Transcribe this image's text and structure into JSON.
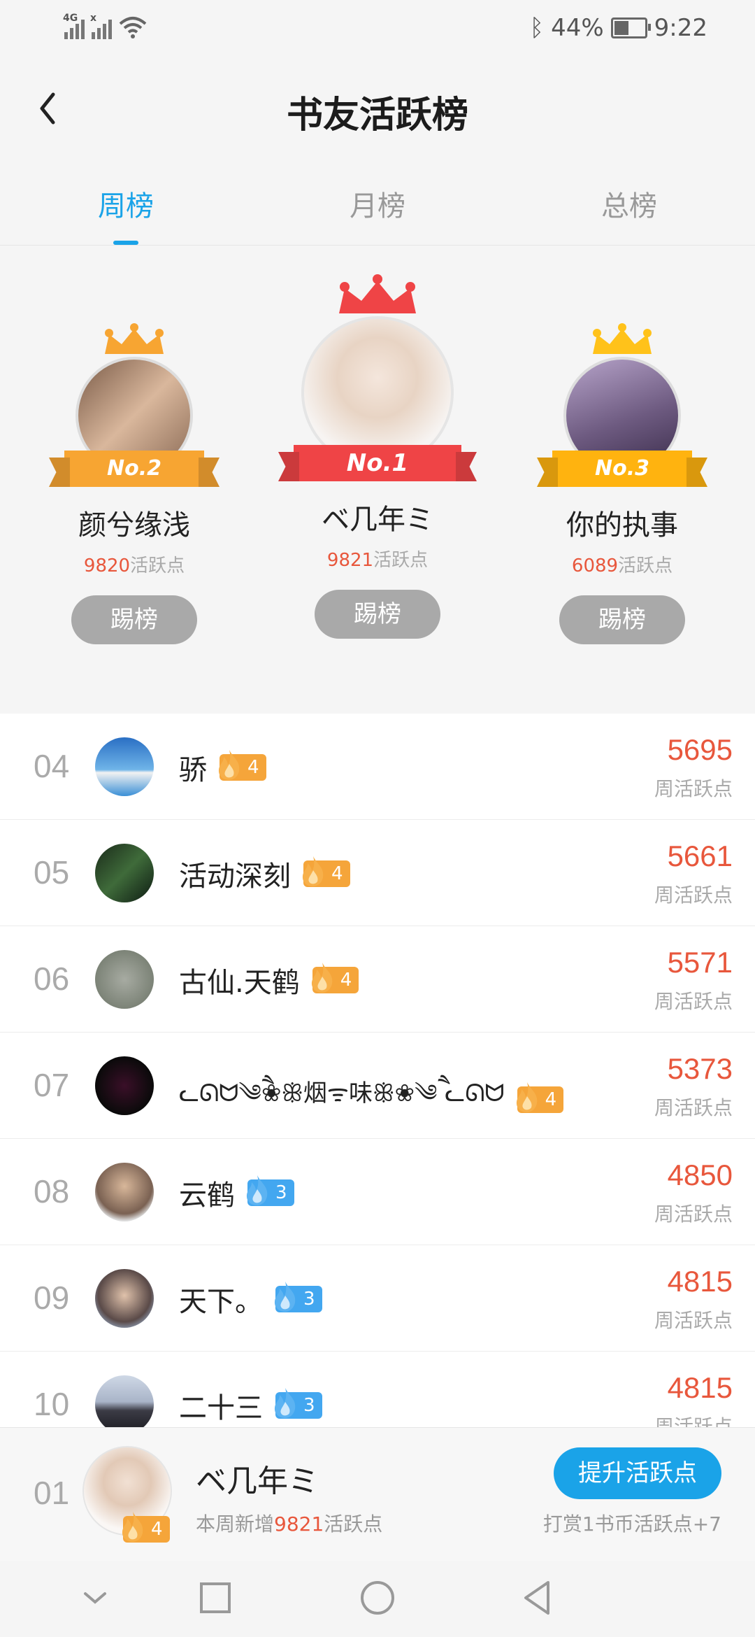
{
  "status_bar": {
    "net1": "4G",
    "net2": "x",
    "battery_text": "44%",
    "battery_level": 0.44,
    "time": "9:22"
  },
  "header": {
    "title": "书友活跃榜"
  },
  "tabs": [
    {
      "label": "周榜",
      "active": true
    },
    {
      "label": "月榜",
      "active": false
    },
    {
      "label": "总榜",
      "active": false
    }
  ],
  "podium": {
    "first": {
      "rank_label": "No.1",
      "name": "ベ几年ミ",
      "score": "9821",
      "unit": "活跃点",
      "button": "踢榜",
      "color": "#ef4446"
    },
    "second": {
      "rank_label": "No.2",
      "name": "颜兮缘浅",
      "score": "9820",
      "unit": "活跃点",
      "button": "踢榜",
      "color": "#f7a532"
    },
    "third": {
      "rank_label": "No.3",
      "name": "你的执事",
      "score": "6089",
      "unit": "活跃点",
      "button": "踢榜",
      "color": "#ffb30f"
    }
  },
  "list": [
    {
      "rank": "04",
      "name": "骄",
      "level": "4",
      "badge": "orange",
      "score": "5695",
      "label": "周活跃点"
    },
    {
      "rank": "05",
      "name": "活动深刻",
      "level": "4",
      "badge": "orange",
      "score": "5661",
      "label": "周活跃点"
    },
    {
      "rank": "06",
      "name": "古仙.天鹤",
      "level": "4",
      "badge": "orange",
      "score": "5571",
      "label": "周活跃点"
    },
    {
      "rank": "07",
      "name": "ᓚᘏᗢ༄ཻ❀ꕥ烟ᯤ味ꕥ❀༄ཻ ᓚᘏᗢ",
      "level": "4",
      "badge": "orange",
      "score": "5373",
      "label": "周活跃点"
    },
    {
      "rank": "08",
      "name": "云鹤",
      "level": "3",
      "badge": "blue",
      "score": "4850",
      "label": "周活跃点"
    },
    {
      "rank": "09",
      "name": "天下。",
      "level": "3",
      "badge": "blue",
      "score": "4815",
      "label": "周活跃点"
    },
    {
      "rank": "10",
      "name": "二十三",
      "level": "3",
      "badge": "blue",
      "score": "4815",
      "label": "周活跃点"
    }
  ],
  "my_rank": {
    "rank": "01",
    "name": "ベ几年ミ",
    "level": "4",
    "sub_prefix": "本周新增",
    "sub_value": "9821",
    "sub_suffix": "活跃点",
    "boost_button": "提升活跃点",
    "reward_text": "打赏1书币活跃点+7"
  }
}
